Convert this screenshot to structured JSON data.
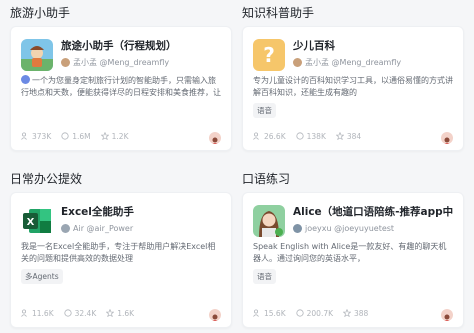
{
  "sections": [
    {
      "title": "旅游小助手",
      "card": {
        "name": "旅途小助手（行程规划）",
        "author": "孟小孟 @Meng_dreamfly",
        "description": "一个为您量身定制旅行计划的智能助手，只需输入旅行地点和天数，便能获得详尽的日程安排和美食推荐，让您的旅途轻松愉快",
        "tag": "",
        "stats": {
          "users": "373K",
          "chats": "1.6M",
          "favorites": "1.2K"
        },
        "avatar_colors": {
          "bg": "#7fc5e8",
          "accent": "#5aa35a"
        }
      }
    },
    {
      "title": "知识科普助手",
      "card": {
        "name": "少儿百科",
        "author": "孟小孟 @Meng_dreamfly",
        "description": "专为儿童设计的百科知识学习工具，以通俗易懂的方式讲解百科知识，还能生成有趣的",
        "tag": "语音",
        "stats": {
          "users": "26.6K",
          "chats": "138K",
          "favorites": "384"
        },
        "avatar_colors": {
          "bg": "#f6c66a",
          "accent": "#ffffff"
        }
      }
    },
    {
      "title": "日常办公提效",
      "card": {
        "name": "Excel全能助手",
        "author": "Air @air_Power",
        "description": "我是一名Excel全能助手，专注于帮助用户解决Excel相关的问题和提供高效的数据处理",
        "tag": "多Agents",
        "stats": {
          "users": "11.6K",
          "chats": "32.4K",
          "favorites": "1.6K"
        },
        "avatar_colors": {
          "bg": "#1f7a45",
          "accent": "#ffffff"
        }
      }
    },
    {
      "title": "口语练习",
      "card": {
        "name": "Alice（地道口语陪练-推荐app中",
        "author": "joeyxu @joeyuyuetest",
        "description": "Speak English with Alice是一款友好、有趣的聊天机器人。通过询问您的英语水平，",
        "tag": "语音",
        "stats": {
          "users": "15.6K",
          "chats": "200.7K",
          "favorites": "388"
        },
        "avatar_colors": {
          "bg": "#8fd0a0",
          "accent": "#4caf50"
        }
      }
    }
  ]
}
